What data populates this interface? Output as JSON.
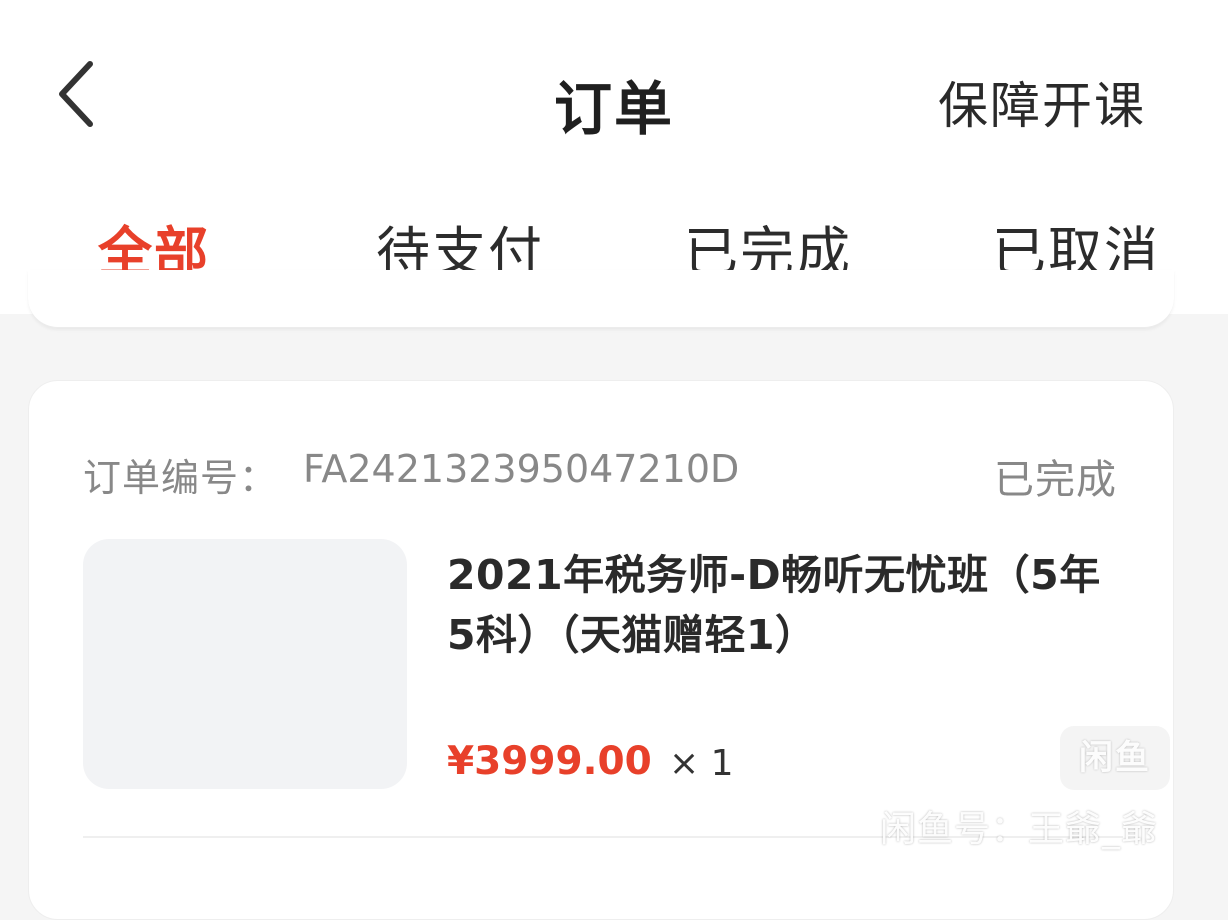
{
  "header": {
    "title": "订单",
    "right_action": "保障开课"
  },
  "tabs": [
    {
      "label": "全部",
      "active": true
    },
    {
      "label": "待支付",
      "active": false
    },
    {
      "label": "已完成",
      "active": false
    },
    {
      "label": "已取消",
      "active": false
    }
  ],
  "order": {
    "order_no_label": "订单编号：",
    "order_no": "FA242132395047210D",
    "status": "已完成",
    "product_name": "2021年税务师-D畅听无忧班（5年5科）（天猫赠轻1）",
    "price": "¥3999.00",
    "quantity": "× 1"
  },
  "watermark": {
    "badge": "闲鱼",
    "text": "闲鱼号：王爺_爺"
  },
  "colors": {
    "accent": "#e8402a",
    "background": "#f5f5f5",
    "card": "#ffffff",
    "muted_text": "#888888"
  }
}
